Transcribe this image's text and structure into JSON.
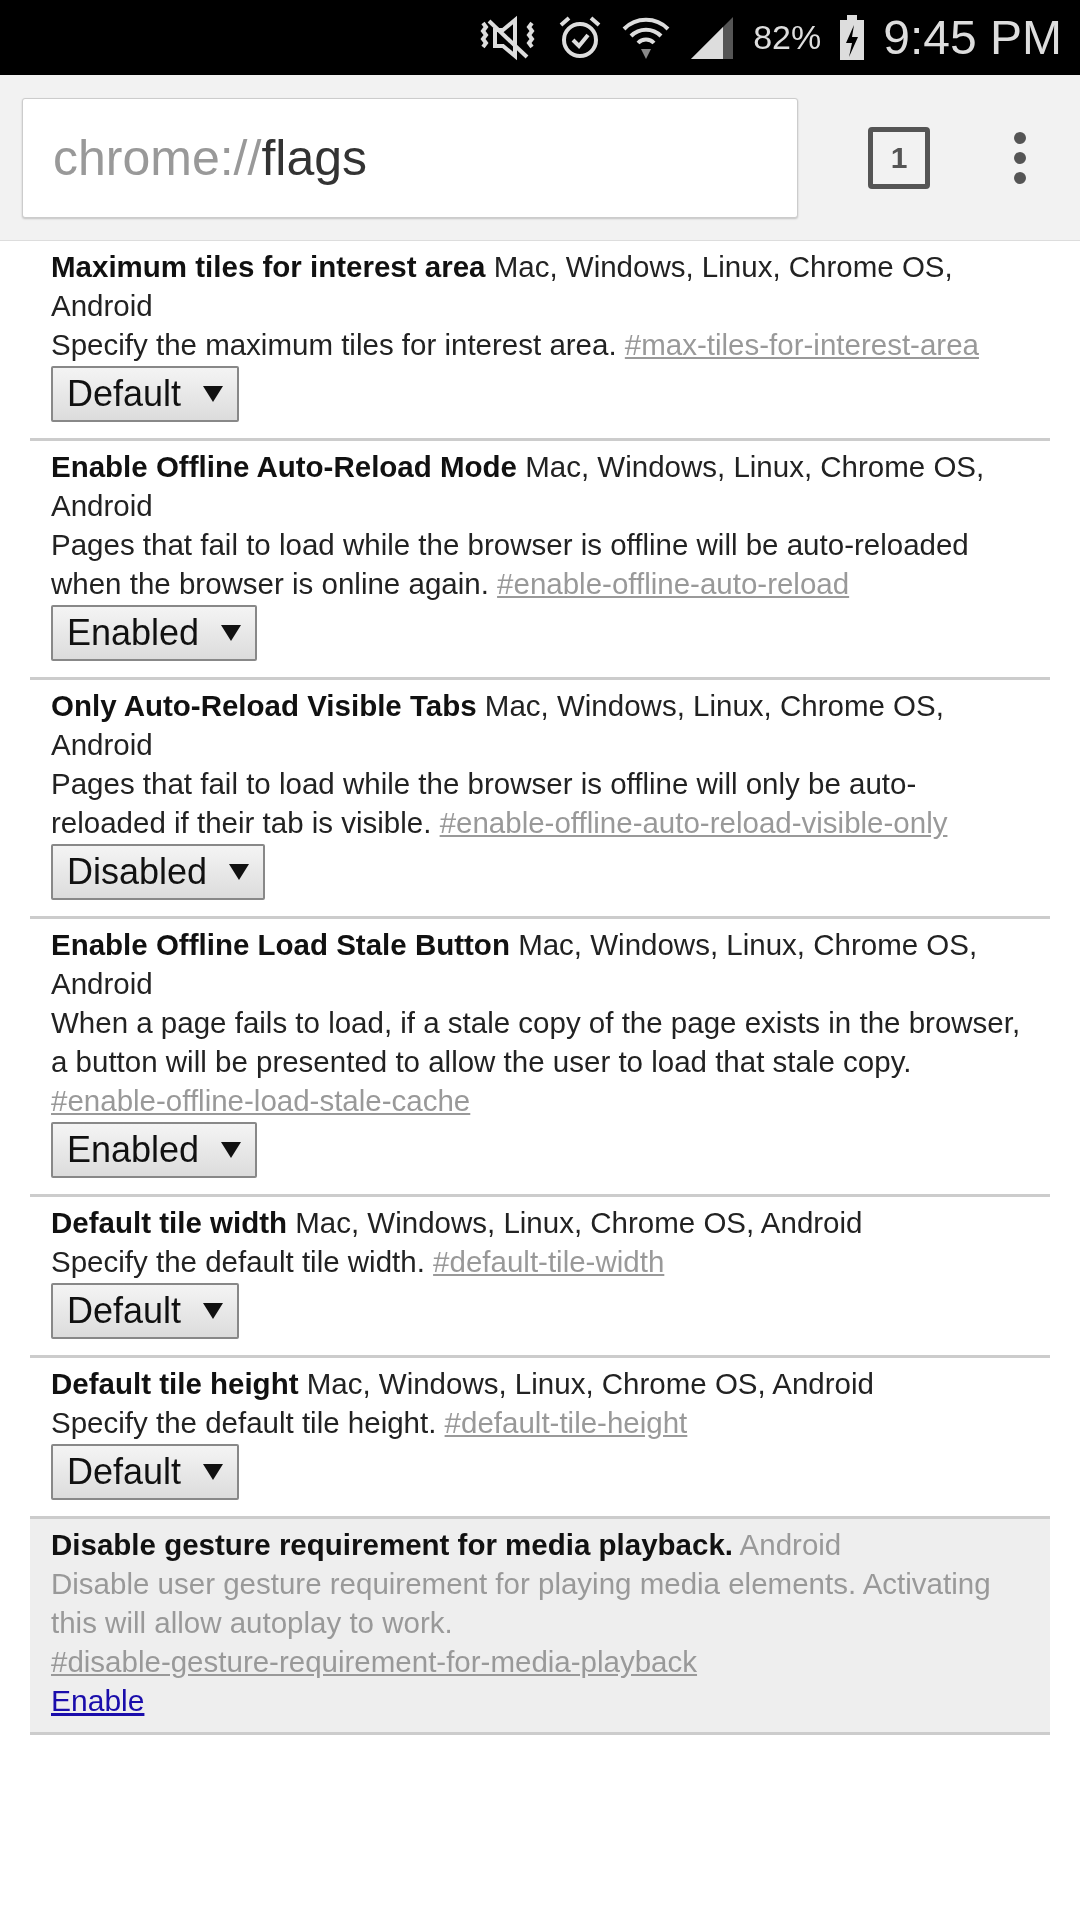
{
  "status_bar": {
    "battery_percent": "82%",
    "time": "9:45 PM"
  },
  "toolbar": {
    "url_scheme": "chrome://",
    "url_path": "flags",
    "tab_count": "1"
  },
  "flags": [
    {
      "title": "Maximum tiles for interest area",
      "platforms": "Mac, Windows, Linux, Chrome OS, Android",
      "description": "Specify the maximum tiles for interest area.",
      "anchor": "#max-tiles-for-interest-area",
      "available": true,
      "control": {
        "kind": "select",
        "value": "Default"
      }
    },
    {
      "title": "Enable Offline Auto-Reload Mode",
      "platforms": "Mac, Windows, Linux, Chrome OS, Android",
      "description": "Pages that fail to load while the browser is offline will be auto-reloaded when the browser is online again.",
      "anchor": "#enable-offline-auto-reload",
      "available": true,
      "control": {
        "kind": "select",
        "value": "Enabled"
      }
    },
    {
      "title": "Only Auto-Reload Visible Tabs",
      "platforms": "Mac, Windows, Linux, Chrome OS, Android",
      "description": "Pages that fail to load while the browser is offline will only be auto-reloaded if their tab is visible.",
      "anchor": "#enable-offline-auto-reload-visible-only",
      "available": true,
      "control": {
        "kind": "select",
        "value": "Disabled"
      }
    },
    {
      "title": "Enable Offline Load Stale Button",
      "platforms": "Mac, Windows, Linux, Chrome OS, Android",
      "description": "When a page fails to load, if a stale copy of the page exists in the browser, a button will be presented to allow the user to load that stale copy.",
      "anchor": "#enable-offline-load-stale-cache",
      "available": true,
      "control": {
        "kind": "select",
        "value": "Enabled"
      }
    },
    {
      "title": "Default tile width",
      "platforms": "Mac, Windows, Linux, Chrome OS, Android",
      "description": "Specify the default tile width.",
      "anchor": "#default-tile-width",
      "available": true,
      "control": {
        "kind": "select",
        "value": "Default"
      }
    },
    {
      "title": "Default tile height",
      "platforms": "Mac, Windows, Linux, Chrome OS, Android",
      "description": "Specify the default tile height.",
      "anchor": "#default-tile-height",
      "available": true,
      "control": {
        "kind": "select",
        "value": "Default"
      }
    },
    {
      "title": "Disable gesture requirement for media playback.",
      "platforms": "Android",
      "description": "Disable user gesture requirement for playing media elements. Activating this will allow autoplay to work.",
      "anchor": "#disable-gesture-requirement-for-media-playback",
      "available": false,
      "control": {
        "kind": "link",
        "label": "Enable"
      }
    }
  ]
}
